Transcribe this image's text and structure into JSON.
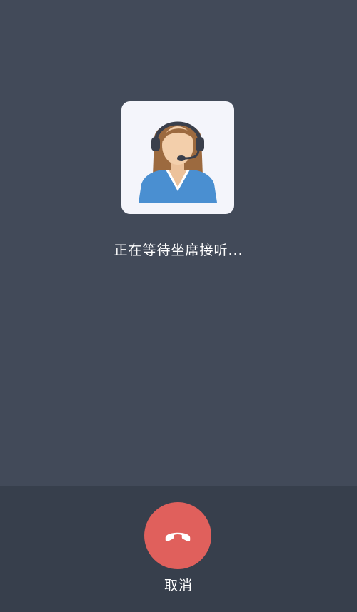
{
  "call": {
    "status_text": "正在等待坐席接听...",
    "cancel_label": "取消"
  },
  "icons": {
    "agent": "customer-service-agent-avatar-icon",
    "hangup": "phone-hangup-icon"
  },
  "colors": {
    "background": "#424a59",
    "bottom_bar": "#373f4c",
    "hangup_button": "#e0605c",
    "avatar_card": "#f4f5fb",
    "text": "#ffffff"
  }
}
